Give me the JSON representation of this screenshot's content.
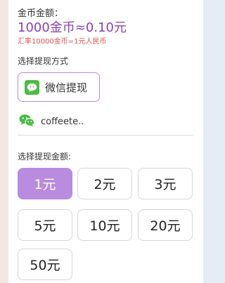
{
  "balance": {
    "label": "金币金额：",
    "value": "1000金币≈0.10元",
    "rate": "汇率10000金币=1元人民币"
  },
  "withdraw_method": {
    "label": "选择提现方式",
    "option_label": "微信提现",
    "icon": "wechat-icon",
    "account_name": "coffeete..",
    "accent_color": "#b98ad6"
  },
  "withdraw_amount": {
    "label": "选择提现金额:",
    "selected": "1元",
    "options": [
      "1元",
      "2元",
      "3元",
      "5元",
      "10元",
      "20元",
      "50元"
    ],
    "selected_color": "#b98ce0"
  }
}
